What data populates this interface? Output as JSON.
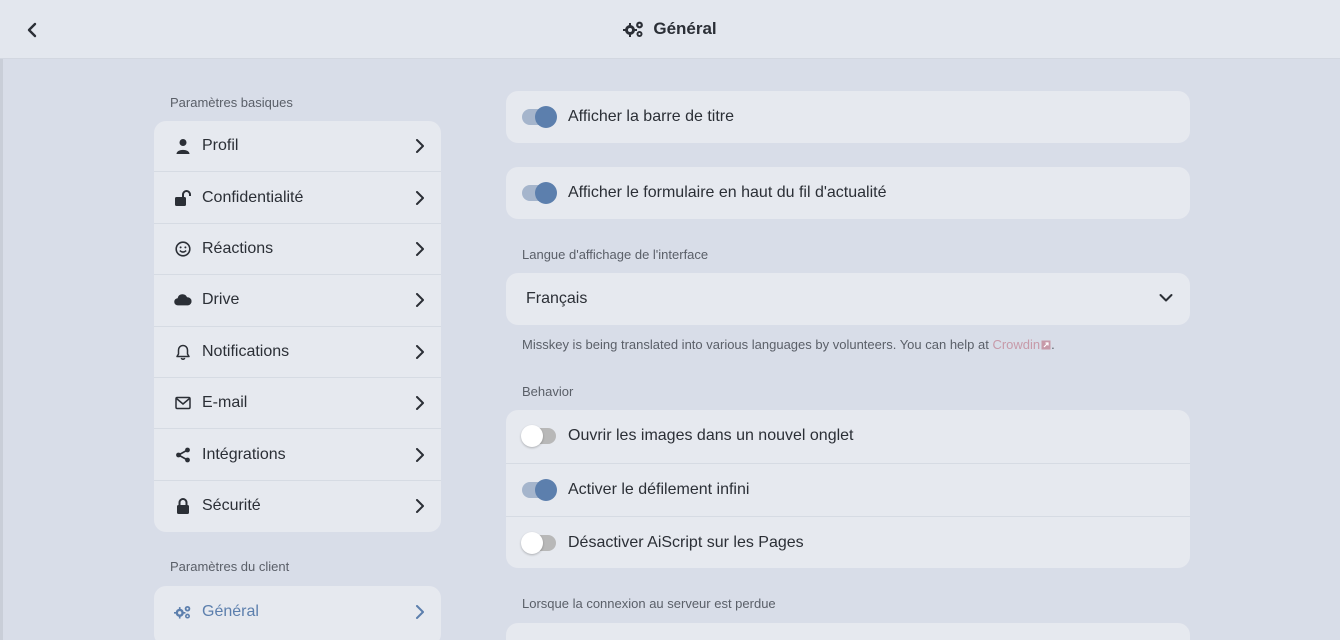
{
  "header": {
    "title": "Général",
    "title_icon": "gears-icon",
    "back_icon": "chevron-left-icon"
  },
  "sidebar": {
    "basic_label": "Paramètres basiques",
    "basic_items": [
      {
        "label": "Profil",
        "icon": "user-icon"
      },
      {
        "label": "Confidentialité",
        "icon": "unlock-icon"
      },
      {
        "label": "Réactions",
        "icon": "smile-icon"
      },
      {
        "label": "Drive",
        "icon": "cloud-icon"
      },
      {
        "label": "Notifications",
        "icon": "bell-icon"
      },
      {
        "label": "E-mail",
        "icon": "envelope-icon"
      },
      {
        "label": "Intégrations",
        "icon": "share-icon"
      },
      {
        "label": "Sécurité",
        "icon": "lock-icon"
      }
    ],
    "client_label": "Paramètres du client",
    "client_items": [
      {
        "label": "Général",
        "icon": "gears-icon",
        "active": true
      }
    ]
  },
  "main": {
    "show_titlebar": {
      "label": "Afficher la barre de titre",
      "on": true
    },
    "show_form_top": {
      "label": "Afficher le formulaire en haut du fil d'actualité",
      "on": true
    },
    "language": {
      "caption": "Langue d'affichage de l'interface",
      "value": "Français",
      "help_prefix": "Misskey is being translated into various languages by volunteers. You can help at ",
      "help_link": "Crowdin",
      "help_suffix": "."
    },
    "behavior": {
      "caption": "Behavior",
      "items": [
        {
          "label": "Ouvrir les images dans un nouvel onglet",
          "on": false
        },
        {
          "label": "Activer le défilement infini",
          "on": true
        },
        {
          "label": "Désactiver AiScript sur les Pages",
          "on": false
        }
      ]
    },
    "connection_caption": "Lorsque la connexion au serveur est perdue"
  },
  "colors": {
    "accent": "#5c7fad",
    "background": "#d8dde8",
    "card": "#e6e9ef",
    "link": "#c79aa9"
  }
}
